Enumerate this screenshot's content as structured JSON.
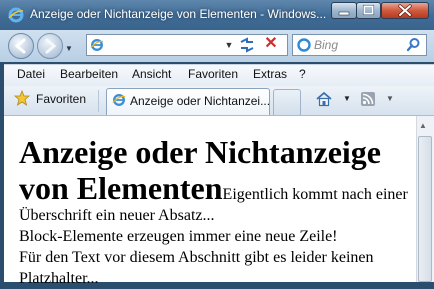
{
  "window": {
    "title": "Anzeige oder Nichtanzeige von Elementen - Windows..."
  },
  "address_bar": {
    "url": ""
  },
  "search": {
    "placeholder": "Bing"
  },
  "menu": {
    "items": [
      "Datei",
      "Bearbeiten",
      "Ansicht",
      "Favoriten",
      "Extras",
      "?"
    ]
  },
  "favorites_bar": {
    "favorites_label": "Favoriten",
    "active_tab_label": "Anzeige oder Nichtanzei..."
  },
  "page": {
    "heading": "Anzeige oder Nichtanzeige von Elementen",
    "lead_text": "Eigentlich kommt nach einer Überschrift ein neuer Absatz...",
    "lines": [
      "Block-Elemente erzeugen immer eine neue Zeile!",
      "Für den Text vor diesem Abschnitt gibt es leider keinen Platzhalter..."
    ]
  },
  "icons": {
    "window": "ie-icon",
    "back": "back-arrow-icon",
    "forward": "forward-arrow-icon",
    "compat": "compatibility-view-icon",
    "stop": "stop-icon",
    "search_provider": "bing-icon",
    "search_go": "magnifier-icon",
    "favorites": "favorites-star-icon",
    "home": "home-icon",
    "feeds": "rss-feed-icon"
  },
  "colors": {
    "titlebar": "#3f6b95",
    "close_button": "#cf5a3f"
  }
}
